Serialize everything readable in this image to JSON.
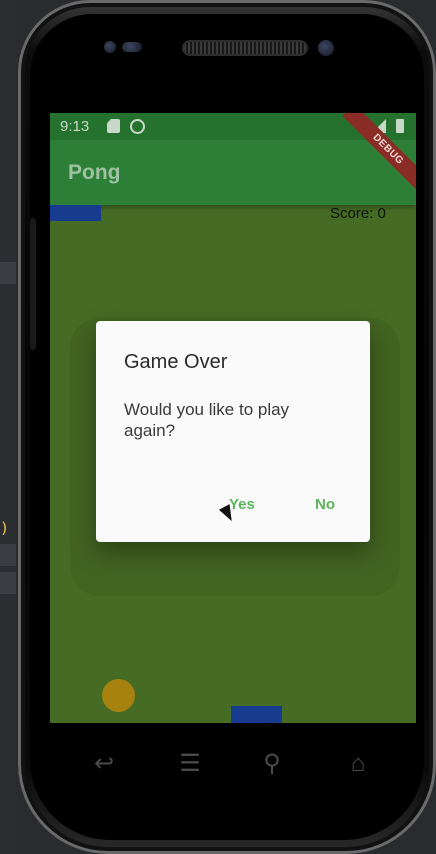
{
  "status": {
    "time": "9:13"
  },
  "app": {
    "title": "Pong",
    "debug_banner": "DEBUG"
  },
  "game": {
    "score_label": "Score: 0"
  },
  "dialog": {
    "title": "Game Over",
    "message": "Would you like to play again?",
    "yes_label": "Yes",
    "no_label": "No"
  },
  "editor": {
    "glyph": ")"
  },
  "colors": {
    "appbar": "#2d7e37",
    "field": "#466b24",
    "paddle": "#173c8f",
    "ball": "#a8820f",
    "dialog_button": "#5cb55b"
  },
  "nav": {
    "back": "back-icon",
    "menu": "menu-icon",
    "search": "search-icon",
    "home": "home-icon"
  }
}
